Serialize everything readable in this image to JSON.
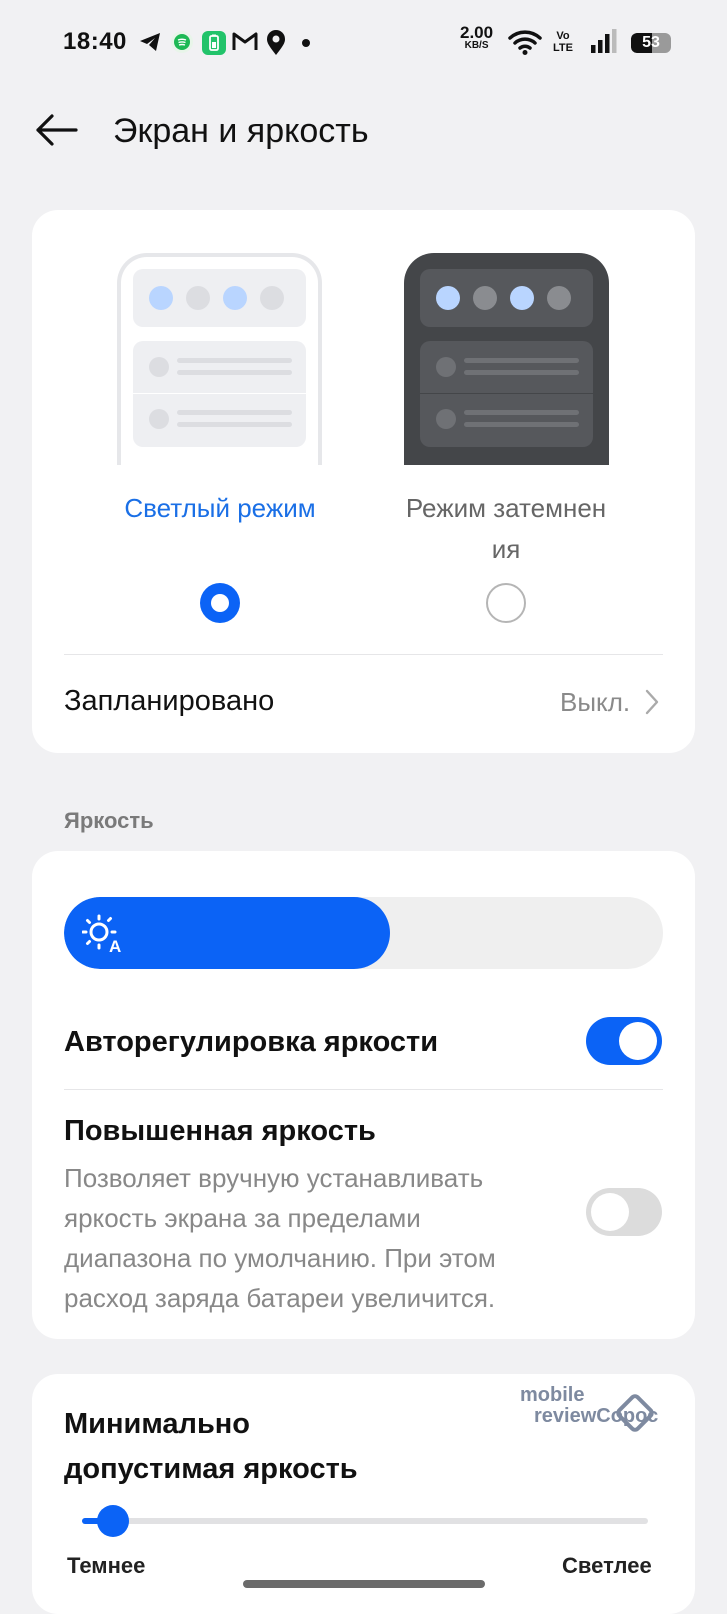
{
  "status_bar": {
    "time": "18:40",
    "net_speed_value": "2.00",
    "net_speed_unit": "KB/S",
    "volte_top": "Vo",
    "volte_bottom": "LTE",
    "battery_level": "53",
    "icons": [
      "telegram-icon",
      "spotify-icon",
      "battery-app-icon",
      "gmail-icon",
      "location-icon",
      "dot-icon",
      "wifi-icon",
      "signal-icon",
      "battery-icon"
    ]
  },
  "header": {
    "title": "Экран и яркость",
    "back_icon": "arrow-left-icon"
  },
  "theme": {
    "light_label": "Светлый режим",
    "dark_label_line1": "Режим затемнен",
    "dark_label_line2": "ия",
    "selected": "light",
    "scheduled_label": "Запланировано",
    "scheduled_value": "Выкл."
  },
  "brightness": {
    "section_label": "Яркость",
    "level": 0.545,
    "auto_label": "Авторегулировка яркости",
    "auto_enabled": true,
    "extra_label": "Повышенная яркость",
    "extra_desc_1": "Позволяет вручную устанавливать",
    "extra_desc_2": "яркость экрана за пределами",
    "extra_desc_3": "диапазона по умолчанию. При этом",
    "extra_desc_4": "расход заряда батареи увеличится.",
    "extra_enabled": false
  },
  "min_brightness": {
    "title_line1": "Минимально",
    "title_line2": "допустимая яркость",
    "level": 0.04,
    "darker_label": "Темнее",
    "lighter_label": "Светлее"
  },
  "watermark": {
    "line1": "mobile",
    "line2": "reviewСорос"
  },
  "colors": {
    "accent": "#0b63f6",
    "background": "#f1f1f3",
    "card": "#ffffff"
  }
}
